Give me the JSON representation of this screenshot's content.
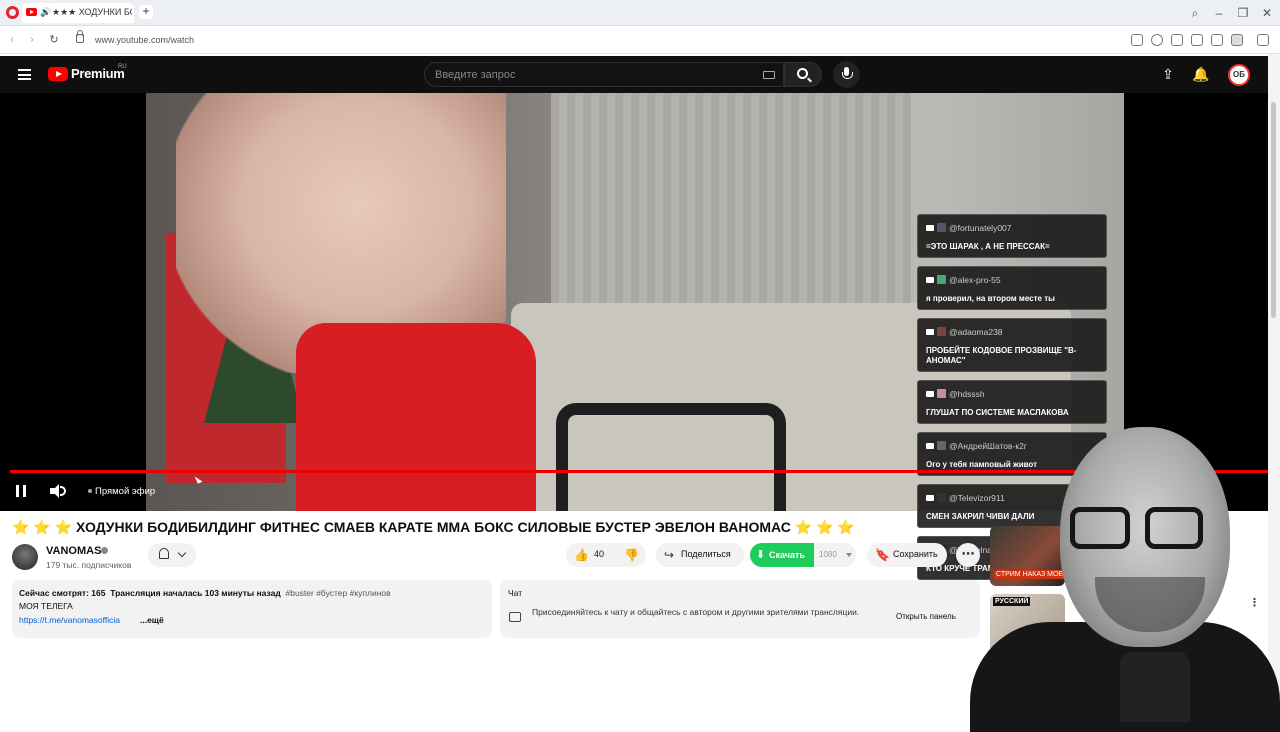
{
  "browser": {
    "tab_title": "★★★ ХОДУНКИ БОДИБИЛДИНГ",
    "address": "www.youtube.com/watch"
  },
  "youtube": {
    "logo_text": "Premium",
    "region": "RU",
    "search_placeholder": "Введите запрос",
    "avatar_initials": "ОБ",
    "colors": {
      "brand_red": "#ff0000",
      "download_green": "#1fcb5b",
      "link_blue": "#065fd4"
    }
  },
  "overlay_chat": [
    {
      "user": "@fortunately007",
      "text": "=ЭТО ШАРАК , А НЕ ПРЕССАК="
    },
    {
      "user": "@alex-pro-55",
      "text": "я проверил, на втором месте ты"
    },
    {
      "user": "@adaoma238",
      "text": "ПРОБЕЙТЕ КОДОВОЕ ПРОЗВИЩЕ \"В-АНОМАС\""
    },
    {
      "user": "@hdsssh",
      "text": "ГЛУШАТ ПО СИСТЕМЕ МАСЛАКОВА"
    },
    {
      "user": "@АндрейШатов-к2г",
      "text": "Ого у тебя памповый живот"
    },
    {
      "user": "@Televizor911",
      "text": "СМЕН ЗАКРИЛ ЧИВИ ДАЛИ"
    },
    {
      "user": "@Werrelnar",
      "text": "КТО КРУЧЕ ТРАМП ИЛИ ВАНОМАС"
    }
  ],
  "player": {
    "live_label": "Прямой эфир",
    "progress_fraction": 1.0
  },
  "video": {
    "title": "⭐ ⭐ ⭐ ХОДУНКИ БОДИБИЛДИНГ ФИТНЕС СМАЕВ КАРАТЕ ММА БОКС СИЛОВЫЕ БУСТЕР ЭВЕЛОН ВАНОМАС ⭐ ⭐ ⭐",
    "channel_name": "VANOMAS",
    "subscribers": "179 тыс. подписчиков",
    "likes": "40",
    "share_label": "Поделиться",
    "download_label": "Скачать",
    "quality": "1080",
    "save_label": "Сохранить"
  },
  "description": {
    "watching": "Сейчас смотрят: 165",
    "started": "Трансляция началась 103 минуты назад",
    "tags": "#buster #бустер #куплинов",
    "line2": "МОЯ ТЕЛЕГА",
    "link": "https://t.me/vanomasofficia",
    "more": "...ещё"
  },
  "chat_panel": {
    "label": "Чат",
    "text": "Присоединяйтесь к чату и общайтесь с автором и другими зрителями трансляции.",
    "open_label": "Открыть панель"
  },
  "sidebar": {
    "thumb1_caption": "СТРИМ НАКАЗ МОЕГО ДНЯ РОЖ",
    "thumb2_caption": "РУССКИЙ"
  }
}
